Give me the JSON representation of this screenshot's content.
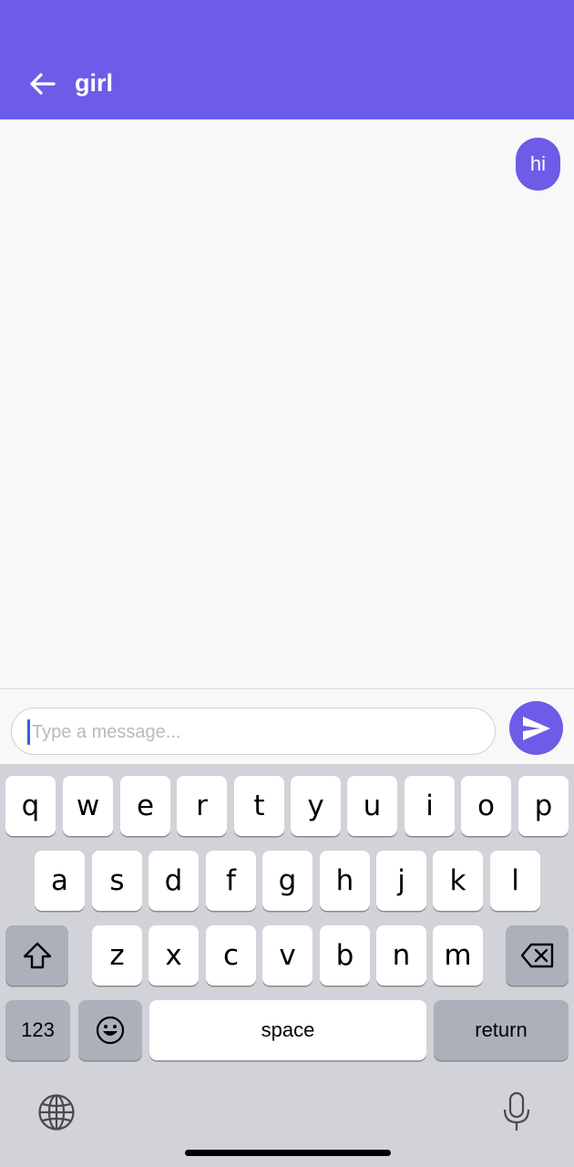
{
  "header": {
    "title": "girl",
    "back_icon": "arrow-left-icon",
    "background": "#6c5ce7"
  },
  "messages": [
    {
      "text": "hi",
      "sender": "me"
    }
  ],
  "composer": {
    "placeholder": "Type a message...",
    "value": "",
    "send_icon": "paper-plane-icon",
    "accent": "#6c5ce7"
  },
  "keyboard": {
    "row1": [
      "q",
      "w",
      "e",
      "r",
      "t",
      "y",
      "u",
      "i",
      "o",
      "p"
    ],
    "row2": [
      "a",
      "s",
      "d",
      "f",
      "g",
      "h",
      "j",
      "k",
      "l"
    ],
    "row3": [
      "z",
      "x",
      "c",
      "v",
      "b",
      "n",
      "m"
    ],
    "shift_icon": "shift-icon",
    "backspace_icon": "backspace-icon",
    "numbers_label": "123",
    "emoji_icon": "emoji-icon",
    "space_label": "space",
    "return_label": "return",
    "globe_icon": "globe-icon",
    "mic_icon": "microphone-icon"
  }
}
